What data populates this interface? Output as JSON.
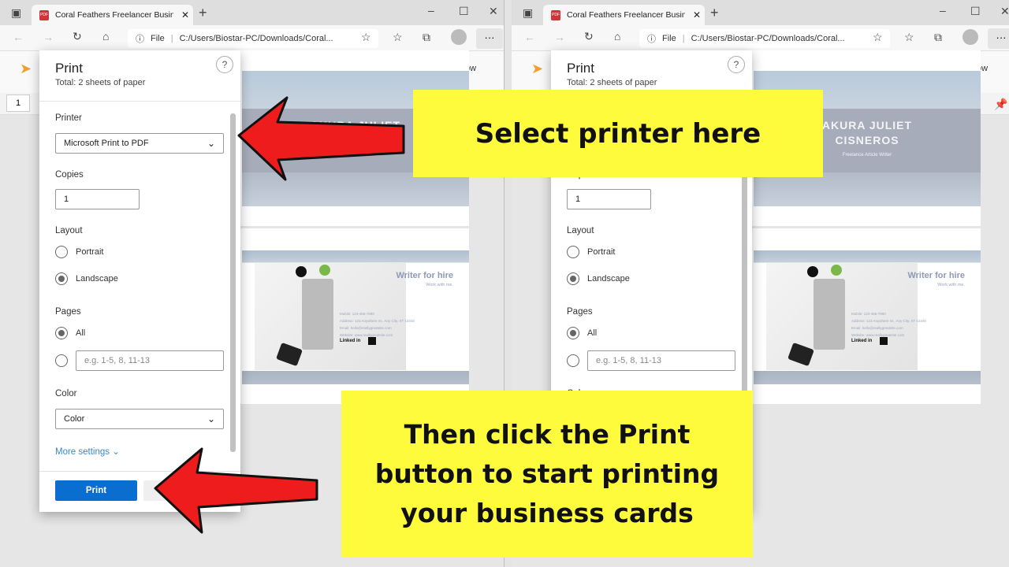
{
  "browser": {
    "tab_title": "Coral Feathers Freelancer Busine",
    "address_scheme": "File",
    "address_url": "C:/Users/Biostar-PC/Downloads/Coral...",
    "page_number": "1",
    "partial_button_text": "ow"
  },
  "print_dialog": {
    "title": "Print",
    "subtitle": "Total: 2 sheets of paper",
    "help": "?",
    "printer_label": "Printer",
    "printer_value": "Microsoft Print to PDF",
    "copies_label": "Copies",
    "copies_value": "1",
    "layout_label": "Layout",
    "layout_options": [
      "Portrait",
      "Landscape"
    ],
    "layout_selected": "Landscape",
    "pages_label": "Pages",
    "pages_all": "All",
    "pages_placeholder": "e.g. 1-5, 8, 11-13",
    "color_label": "Color",
    "color_value": "Color",
    "more_settings": "More settings",
    "print_button": "Print"
  },
  "preview": {
    "card_front": {
      "name": "AKURA JULIET\nCISNEROS",
      "role": "Freelance Article Writer"
    },
    "card_back": {
      "heading": "Writer for hire",
      "tagline": "Work with me.",
      "contact": [
        "Mobile: 123-456-7890",
        "Address: 123 Anywhere St., Any City, ST 12345",
        "Email: hello@reallygreatsite.com",
        "Website: www.reallygreatsite.com"
      ],
      "linkedin": "Linked in"
    }
  },
  "callouts": {
    "select_printer": "Select printer here",
    "click_print": "Then click the Print button to start printing your business cards"
  },
  "colors": {
    "callout_bg": "#fefb3c",
    "arrow": "#ee1c1c",
    "print_button": "#0a6ed1"
  }
}
